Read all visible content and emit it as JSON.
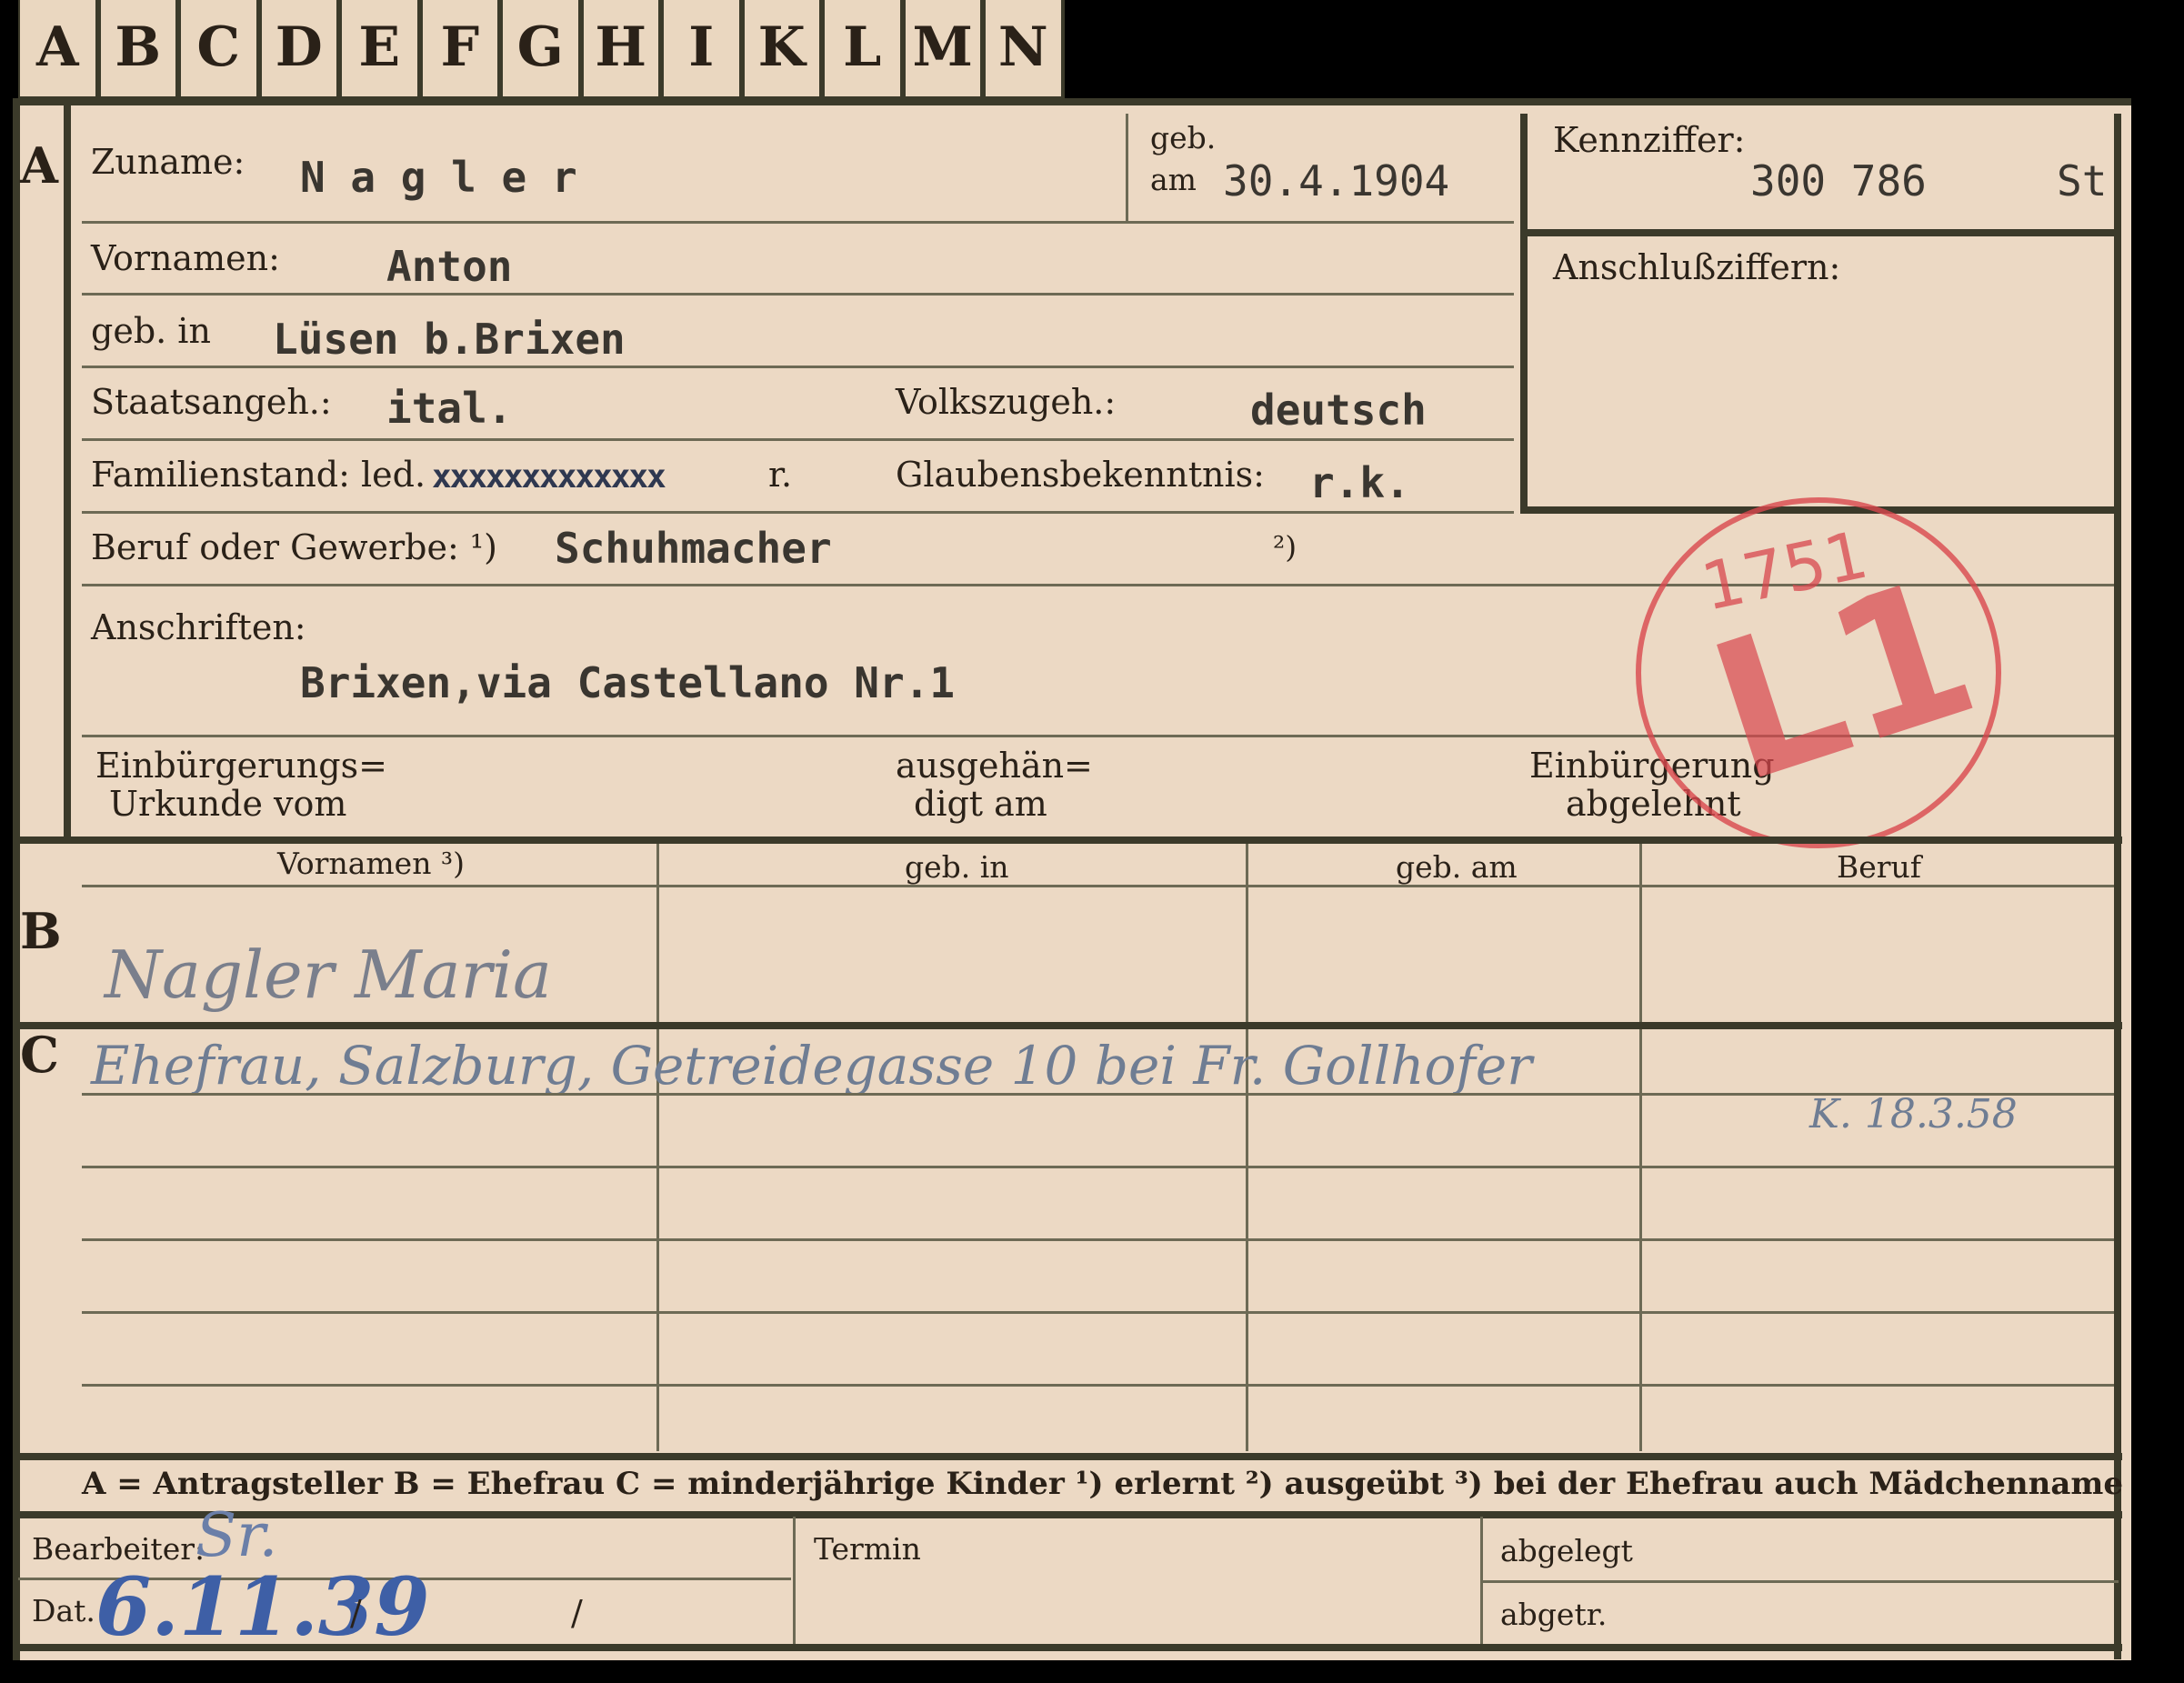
{
  "tabs": [
    "A",
    "B",
    "C",
    "D",
    "E",
    "F",
    "G",
    "H",
    "I",
    "K",
    "L",
    "M",
    "N"
  ],
  "section_marks": {
    "a": "A",
    "b": "B",
    "c": "C"
  },
  "head": {
    "zuname_label": "Zuname:",
    "zuname_value": "N a g l e r",
    "geb_label_1": "geb.",
    "geb_label_2": "am",
    "geb_value": "30.4.1904",
    "kennziffer_label": "Kennziffer:",
    "kennziffer_value": "300 786",
    "kennziffer_suffix": "St",
    "anschluss_label": "Anschlußziffern:"
  },
  "fields": {
    "vornamen_label": "Vornamen:",
    "vornamen_value": "Anton",
    "gebin_label": "geb. in",
    "gebin_value": "Lüsen b.Brixen",
    "staats_label": "Staatsangeh.:",
    "staats_value": "ital.",
    "volks_label": "Volkszugeh.:",
    "volks_value": "deutsch",
    "familien_label": "Familienstand: led.",
    "familien_struck": "xxxxxxxxxxxxx",
    "familien_tail": "r.",
    "glauben_label": "Glaubensbekenntnis:",
    "glauben_value": "r.k.",
    "beruf_label": "Beruf oder Gewerbe: ¹)",
    "beruf_value": "Schuhmacher",
    "beruf_note2": "²)",
    "anschriften_label": "Anschriften:",
    "anschriften_value": "Brixen,via Castellano Nr.1",
    "einb_label_1": "Einbürgerungs=",
    "einb_label_2": "Urkunde vom",
    "ausg_label_1": "ausgehän=",
    "ausg_label_2": "digt am",
    "abgel_label_1": "Einbürgerung",
    "abgel_label_2": "abgelehnt"
  },
  "stamp": {
    "number": "1751",
    "code": "L1",
    "color": "#d9474e"
  },
  "table": {
    "headers": [
      "Vornamen ³)",
      "geb. in",
      "geb. am",
      "Beruf"
    ],
    "b_row_hand": "Nagler Maria",
    "c_row_hand": "Ehefrau, Salzburg, Getreidegasse 10 bei Fr. Gollhofer",
    "c_row_date": "K. 18.3.58"
  },
  "legend": "A = Antragsteller   B = Ehefrau   C = minderjährige Kinder   ¹) erlernt   ²) ausgeübt   ³) bei der Ehefrau auch Mädchenname",
  "footer": {
    "bearbeiter_label": "Bearbeiter:",
    "bearbeiter_hand": "Sr.",
    "dat_label": "Dat.",
    "dat_hand": "6.11.39",
    "slash_1": "/",
    "slash_2": "/",
    "termin_label": "Termin",
    "abgelegt_label": "abgelegt",
    "abgetr_label": "abgetr."
  },
  "colors": {
    "paper": "#ecd9c4",
    "ink": "#2a2118",
    "rule": "#6d6a55",
    "frame": "#3b3a2a",
    "hand": "#5b6a8a"
  }
}
